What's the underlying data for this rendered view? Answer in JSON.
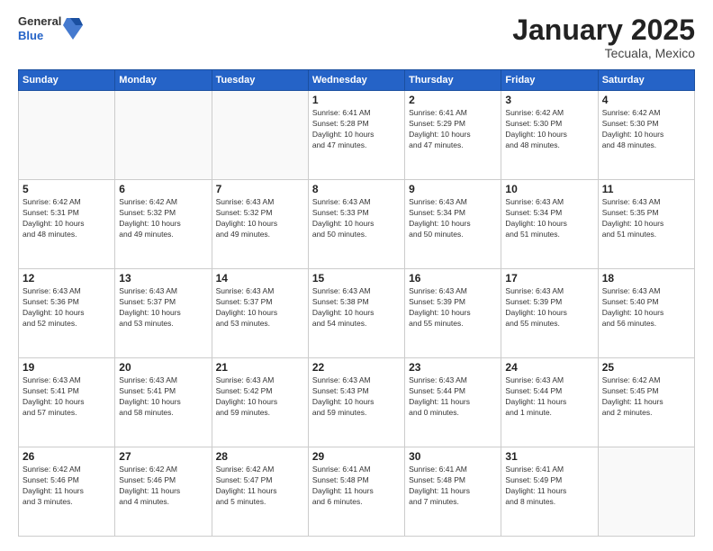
{
  "header": {
    "logo": {
      "general": "General",
      "blue": "Blue"
    },
    "title": "January 2025",
    "subtitle": "Tecuala, Mexico"
  },
  "calendar": {
    "days_of_week": [
      "Sunday",
      "Monday",
      "Tuesday",
      "Wednesday",
      "Thursday",
      "Friday",
      "Saturday"
    ],
    "weeks": [
      [
        {
          "day": "",
          "info": ""
        },
        {
          "day": "",
          "info": ""
        },
        {
          "day": "",
          "info": ""
        },
        {
          "day": "1",
          "info": "Sunrise: 6:41 AM\nSunset: 5:28 PM\nDaylight: 10 hours\nand 47 minutes."
        },
        {
          "day": "2",
          "info": "Sunrise: 6:41 AM\nSunset: 5:29 PM\nDaylight: 10 hours\nand 47 minutes."
        },
        {
          "day": "3",
          "info": "Sunrise: 6:42 AM\nSunset: 5:30 PM\nDaylight: 10 hours\nand 48 minutes."
        },
        {
          "day": "4",
          "info": "Sunrise: 6:42 AM\nSunset: 5:30 PM\nDaylight: 10 hours\nand 48 minutes."
        }
      ],
      [
        {
          "day": "5",
          "info": "Sunrise: 6:42 AM\nSunset: 5:31 PM\nDaylight: 10 hours\nand 48 minutes."
        },
        {
          "day": "6",
          "info": "Sunrise: 6:42 AM\nSunset: 5:32 PM\nDaylight: 10 hours\nand 49 minutes."
        },
        {
          "day": "7",
          "info": "Sunrise: 6:43 AM\nSunset: 5:32 PM\nDaylight: 10 hours\nand 49 minutes."
        },
        {
          "day": "8",
          "info": "Sunrise: 6:43 AM\nSunset: 5:33 PM\nDaylight: 10 hours\nand 50 minutes."
        },
        {
          "day": "9",
          "info": "Sunrise: 6:43 AM\nSunset: 5:34 PM\nDaylight: 10 hours\nand 50 minutes."
        },
        {
          "day": "10",
          "info": "Sunrise: 6:43 AM\nSunset: 5:34 PM\nDaylight: 10 hours\nand 51 minutes."
        },
        {
          "day": "11",
          "info": "Sunrise: 6:43 AM\nSunset: 5:35 PM\nDaylight: 10 hours\nand 51 minutes."
        }
      ],
      [
        {
          "day": "12",
          "info": "Sunrise: 6:43 AM\nSunset: 5:36 PM\nDaylight: 10 hours\nand 52 minutes."
        },
        {
          "day": "13",
          "info": "Sunrise: 6:43 AM\nSunset: 5:37 PM\nDaylight: 10 hours\nand 53 minutes."
        },
        {
          "day": "14",
          "info": "Sunrise: 6:43 AM\nSunset: 5:37 PM\nDaylight: 10 hours\nand 53 minutes."
        },
        {
          "day": "15",
          "info": "Sunrise: 6:43 AM\nSunset: 5:38 PM\nDaylight: 10 hours\nand 54 minutes."
        },
        {
          "day": "16",
          "info": "Sunrise: 6:43 AM\nSunset: 5:39 PM\nDaylight: 10 hours\nand 55 minutes."
        },
        {
          "day": "17",
          "info": "Sunrise: 6:43 AM\nSunset: 5:39 PM\nDaylight: 10 hours\nand 55 minutes."
        },
        {
          "day": "18",
          "info": "Sunrise: 6:43 AM\nSunset: 5:40 PM\nDaylight: 10 hours\nand 56 minutes."
        }
      ],
      [
        {
          "day": "19",
          "info": "Sunrise: 6:43 AM\nSunset: 5:41 PM\nDaylight: 10 hours\nand 57 minutes."
        },
        {
          "day": "20",
          "info": "Sunrise: 6:43 AM\nSunset: 5:41 PM\nDaylight: 10 hours\nand 58 minutes."
        },
        {
          "day": "21",
          "info": "Sunrise: 6:43 AM\nSunset: 5:42 PM\nDaylight: 10 hours\nand 59 minutes."
        },
        {
          "day": "22",
          "info": "Sunrise: 6:43 AM\nSunset: 5:43 PM\nDaylight: 10 hours\nand 59 minutes."
        },
        {
          "day": "23",
          "info": "Sunrise: 6:43 AM\nSunset: 5:44 PM\nDaylight: 11 hours\nand 0 minutes."
        },
        {
          "day": "24",
          "info": "Sunrise: 6:43 AM\nSunset: 5:44 PM\nDaylight: 11 hours\nand 1 minute."
        },
        {
          "day": "25",
          "info": "Sunrise: 6:42 AM\nSunset: 5:45 PM\nDaylight: 11 hours\nand 2 minutes."
        }
      ],
      [
        {
          "day": "26",
          "info": "Sunrise: 6:42 AM\nSunset: 5:46 PM\nDaylight: 11 hours\nand 3 minutes."
        },
        {
          "day": "27",
          "info": "Sunrise: 6:42 AM\nSunset: 5:46 PM\nDaylight: 11 hours\nand 4 minutes."
        },
        {
          "day": "28",
          "info": "Sunrise: 6:42 AM\nSunset: 5:47 PM\nDaylight: 11 hours\nand 5 minutes."
        },
        {
          "day": "29",
          "info": "Sunrise: 6:41 AM\nSunset: 5:48 PM\nDaylight: 11 hours\nand 6 minutes."
        },
        {
          "day": "30",
          "info": "Sunrise: 6:41 AM\nSunset: 5:48 PM\nDaylight: 11 hours\nand 7 minutes."
        },
        {
          "day": "31",
          "info": "Sunrise: 6:41 AM\nSunset: 5:49 PM\nDaylight: 11 hours\nand 8 minutes."
        },
        {
          "day": "",
          "info": ""
        }
      ]
    ]
  }
}
